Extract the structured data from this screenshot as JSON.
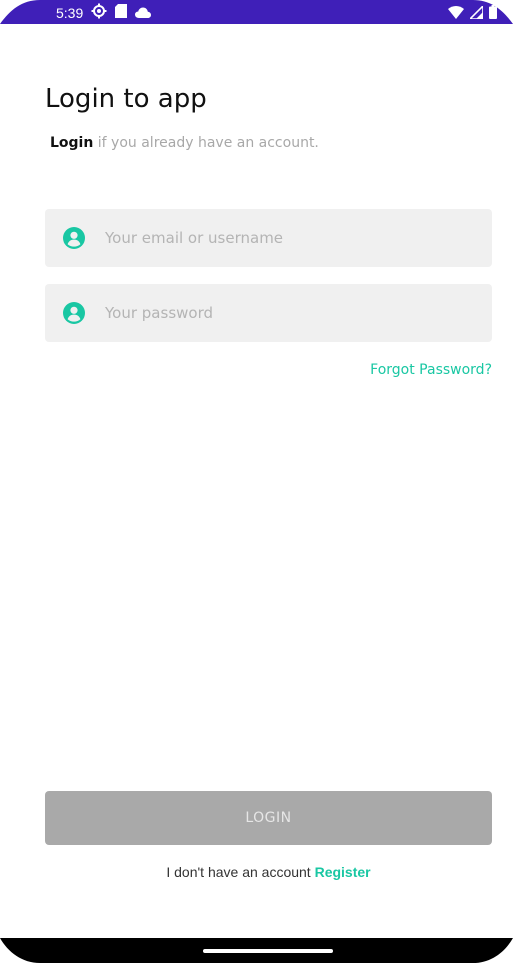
{
  "status_bar": {
    "time": "5:39",
    "left_icons": [
      "settings-icon",
      "sd-card-icon",
      "cloud-icon"
    ],
    "right_icons": [
      "wifi-icon",
      "signal-icon",
      "battery-icon"
    ],
    "background": "#3f1fb8"
  },
  "header": {
    "title": "Login to app",
    "subtitle_strong": "Login",
    "subtitle_rest": " if you already have an account."
  },
  "form": {
    "email": {
      "placeholder": "Your email or username",
      "value": ""
    },
    "password": {
      "placeholder": "Your password",
      "value": ""
    },
    "forgot_label": "Forgot Password?"
  },
  "actions": {
    "login_label": "LOGIN",
    "register_prompt": "I don't have an account ",
    "register_label": "Register"
  },
  "colors": {
    "accent": "#19c7a3",
    "button_disabled": "#a9a9a9",
    "input_bg": "#f0f0f0"
  }
}
